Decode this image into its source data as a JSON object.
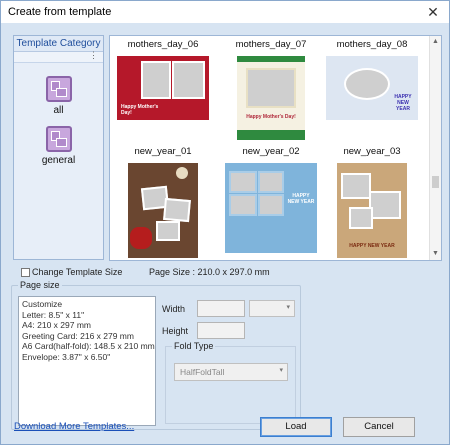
{
  "window": {
    "title": "Create from template",
    "close_glyph": "✕"
  },
  "sidebar": {
    "header": "Template Category",
    "grip": "⋮",
    "items": [
      {
        "label": "all",
        "icon": "photo-collage-icon"
      },
      {
        "label": "general",
        "icon": "photo-collage-icon"
      }
    ]
  },
  "gallery": {
    "thumbnails": [
      {
        "name": "mothers_day_06",
        "greeting": "Happy Mother's Day!"
      },
      {
        "name": "mothers_day_07",
        "greeting": "Happy Mother's Day!"
      },
      {
        "name": "mothers_day_08",
        "greeting": "HAPPY NEW YEAR"
      },
      {
        "name": "new_year_01",
        "greeting": ""
      },
      {
        "name": "new_year_02",
        "greeting": "HAPPY NEW YEAR"
      },
      {
        "name": "new_year_03",
        "greeting": "HAPPY NEW YEAR"
      }
    ],
    "scroll_up": "▲",
    "scroll_down": "▼"
  },
  "change_template_size": {
    "label": "Change Template Size",
    "checked": false
  },
  "page_size_info": "Page Size : 210.0 x 297.0 mm",
  "page_size_group": {
    "title": "Page size",
    "options": [
      "Customize",
      "Letter: 8.5\" x 11\"",
      "A4: 210 x 297 mm",
      "Greeting Card: 216 x 279 mm",
      "A6 Card(half-fold): 148.5 x 210 mm",
      "Envelope: 3.87\" x 6.50\""
    ],
    "width_label": "Width",
    "height_label": "Height",
    "width_value": "",
    "height_value": "",
    "unit_caret": "▾",
    "fold_type": {
      "title": "Fold Type",
      "value": "HalfFoldTall",
      "caret": "▾"
    }
  },
  "footer": {
    "download_link": "Download More Templates...",
    "load_button": "Load",
    "cancel_button": "Cancel"
  }
}
